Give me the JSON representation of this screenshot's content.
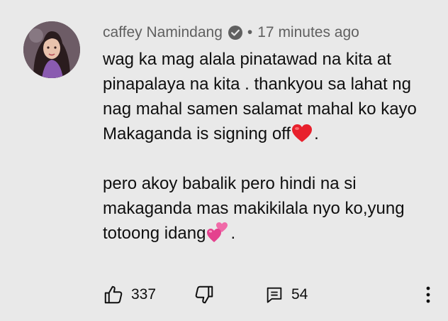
{
  "comment": {
    "author": "caffey Namindang",
    "separator": "•",
    "timestamp": "17 minutes ago",
    "paragraph1_text": "wag ka mag alala pinatawad na kita at pinapalaya na kita . thankyou sa lahat ng nag mahal samen salamat mahal ko kayo Makaganda is signing off",
    "paragraph1_end": ".",
    "paragraph2_text": "pero akoy babalik pero hindi na si makaganda mas makikilala nyo ko,yung totoong idang",
    "paragraph2_end": "."
  },
  "actions": {
    "likes": "337",
    "replies": "54"
  },
  "icons": {
    "verified": "verified-check-icon",
    "heart": "red-heart-emoji",
    "hearts": "two-hearts-emoji",
    "like": "thumbs-up-icon",
    "dislike": "thumbs-down-icon",
    "reply": "comment-icon",
    "more": "more-vert-icon"
  },
  "colors": {
    "background": "#e9e9e9",
    "meta_text": "#606060",
    "body_text": "#0f0f0f",
    "heart_red": "#e8202c",
    "heart_pink": "#f06aa8"
  }
}
